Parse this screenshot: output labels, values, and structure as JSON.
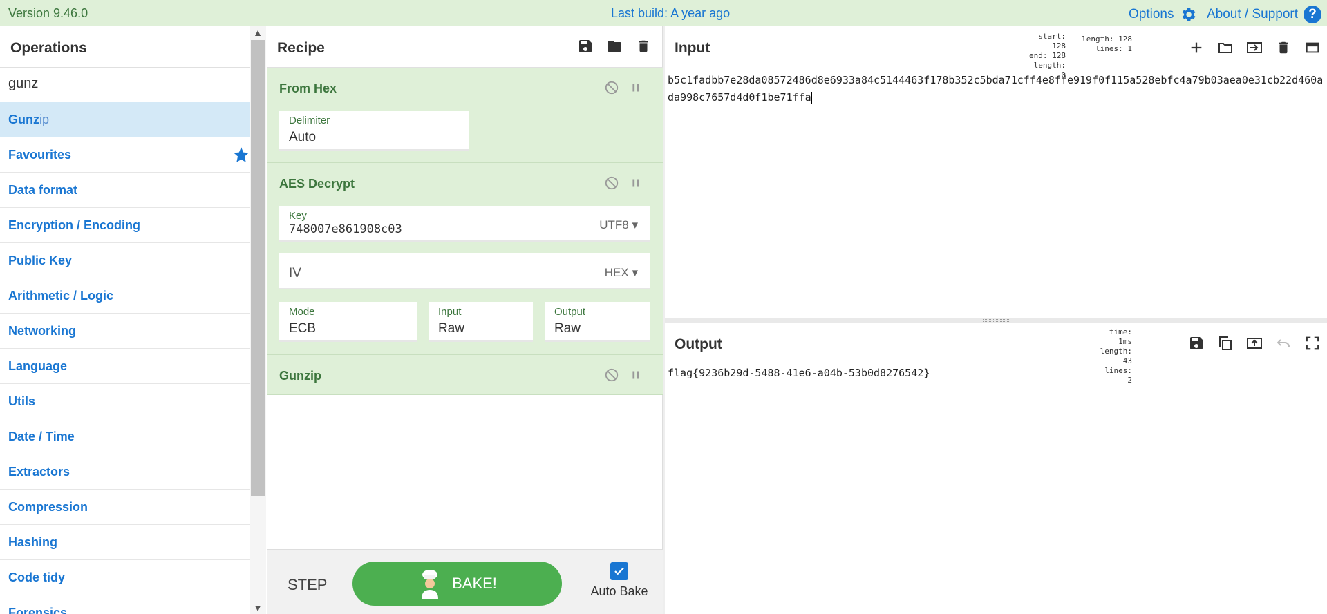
{
  "banner": {
    "version": "Version 9.46.0",
    "last_build": "Last build: A year ago",
    "options": "Options",
    "about": "About / Support"
  },
  "operations": {
    "title": "Operations",
    "search_value": "gunz",
    "result": {
      "match": "Gunz",
      "rest": "ip"
    },
    "categories": [
      "Favourites",
      "Data format",
      "Encryption / Encoding",
      "Public Key",
      "Arithmetic / Logic",
      "Networking",
      "Language",
      "Utils",
      "Date / Time",
      "Extractors",
      "Compression",
      "Hashing",
      "Code tidy",
      "Forensics"
    ]
  },
  "recipe": {
    "title": "Recipe",
    "ops": {
      "from_hex": {
        "name": "From Hex",
        "delimiter_label": "Delimiter",
        "delimiter_value": "Auto"
      },
      "aes": {
        "name": "AES Decrypt",
        "key_label": "Key",
        "key_value": "748007e861908c03",
        "key_encoding": "UTF8",
        "iv_placeholder": "IV",
        "iv_encoding": "HEX",
        "mode_label": "Mode",
        "mode_value": "ECB",
        "input_label": "Input",
        "input_value": "Raw",
        "output_label": "Output",
        "output_value": "Raw"
      },
      "gunzip": {
        "name": "Gunzip"
      }
    },
    "step_label": "STEP",
    "bake_label": "BAKE!",
    "auto_bake_label": "Auto Bake",
    "auto_bake_checked": true
  },
  "input": {
    "title": "Input",
    "stats": {
      "start": "start: 128",
      "end": "end: 128",
      "sel_length": "length:   0",
      "length": "length: 128",
      "lines": "lines:   1"
    },
    "text": "b5c1fadbb7e28da08572486d8e6933a84c5144463f178b352c5bda71cff4e8ffe919f0f115a528ebfc4a79b03aea0e31cb22d460ada998c7657d4d0f1be71ffa"
  },
  "output": {
    "title": "Output",
    "stats": {
      "time": "time:   1ms",
      "length": "length:   43",
      "lines": "lines:    2"
    },
    "text": "flag{9236b29d-5488-41e6-a04b-53b0d8276542}"
  },
  "colors": {
    "banner_bg": "#dff0d8",
    "link_blue": "#1976d2",
    "op_green_bg": "#dff0d8",
    "op_green_text": "#3c763d",
    "bake_green": "#4caf50"
  }
}
